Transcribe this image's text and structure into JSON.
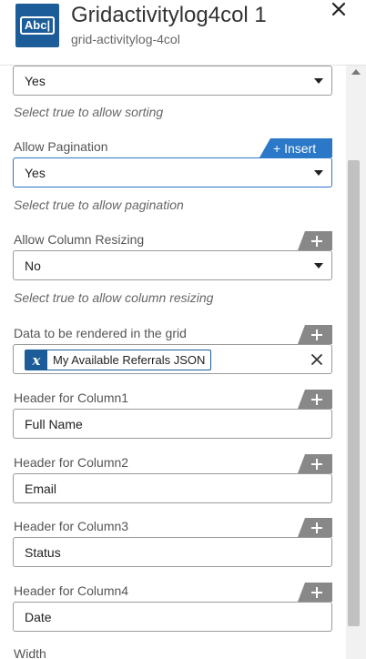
{
  "header": {
    "icon_text": "Abc|",
    "title": "Gridactivitylog4col 1",
    "subtitle": "grid-activitylog-4col"
  },
  "fields": {
    "sorting": {
      "value": "Yes",
      "hint": "Select true to allow sorting"
    },
    "pagination": {
      "label": "Allow Pagination",
      "value": "Yes",
      "hint": "Select true to allow pagination",
      "insert_label": "+ Insert"
    },
    "resizing": {
      "label": "Allow Column Resizing",
      "value": "No",
      "hint": "Select true to allow column resizing"
    },
    "grid_data": {
      "label": "Data to be rendered in the grid",
      "chip_icon": "x",
      "chip_text": "My Available Referrals JSON"
    },
    "col1": {
      "label": "Header for Column1",
      "value": "Full Name"
    },
    "col2": {
      "label": "Header for Column2",
      "value": "Email"
    },
    "col3": {
      "label": "Header for Column3",
      "value": "Status"
    },
    "col4": {
      "label": "Header for Column4",
      "value": "Date"
    },
    "width": {
      "label": "Width"
    }
  },
  "colors": {
    "accent": "#1c5d99",
    "insert": "#2a78c7",
    "tab": "#888888"
  }
}
